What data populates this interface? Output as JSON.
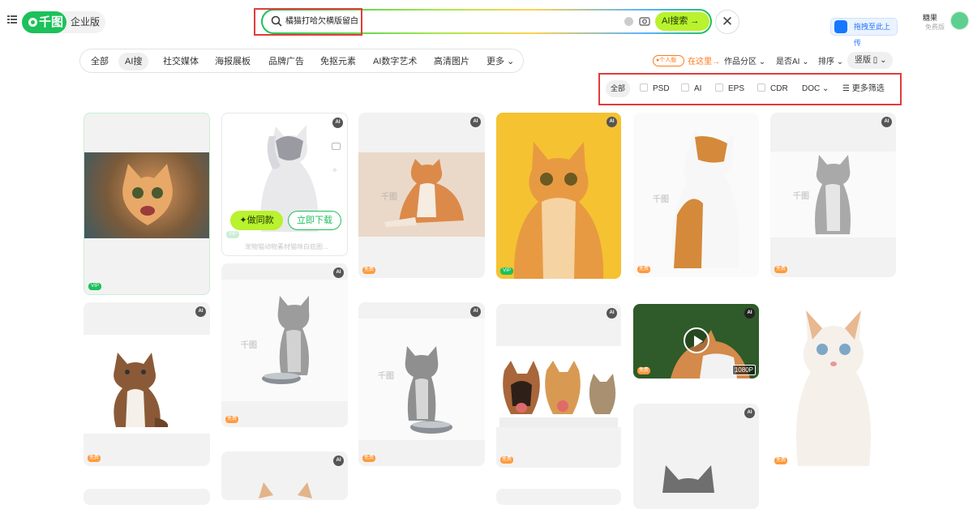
{
  "header": {
    "logo_text": "千图",
    "edition": "企业版",
    "search_value": "橘猫打哈欠横版留白",
    "search_button": "AI搜索",
    "upload_label": "拖拽至此上传",
    "user_name": "糖果",
    "user_sub": "免费版"
  },
  "tabs": [
    "全部",
    "AI搜",
    "社交媒体",
    "海报展板",
    "品牌广告",
    "免抠元素",
    "AI数字艺术",
    "高清图片",
    "更多"
  ],
  "right_filters": {
    "personal_badge": "个人版",
    "here_link": "在这里→",
    "zone": "作品分区",
    "is_ai": "是否AI",
    "sort": "排序",
    "orientation": "竖版"
  },
  "format_filters": {
    "all": "全部",
    "options": [
      "PSD",
      "AI",
      "EPS",
      "CDR"
    ],
    "doc": "DOC",
    "more": "更多筛选"
  },
  "cards": {
    "ai_badge": "AI",
    "vip": "VIP",
    "free": "免费",
    "make_same": "做同款",
    "download_now": "立即下载",
    "hover_title": "宠物猫动物素材猫咪白底图...",
    "video_res": "1080P"
  },
  "colors": {
    "brand_green": "#1cc15a",
    "accent_lime": "#b9f22e",
    "highlight_red": "#e23b3b",
    "free_orange": "#ff9a3c"
  }
}
